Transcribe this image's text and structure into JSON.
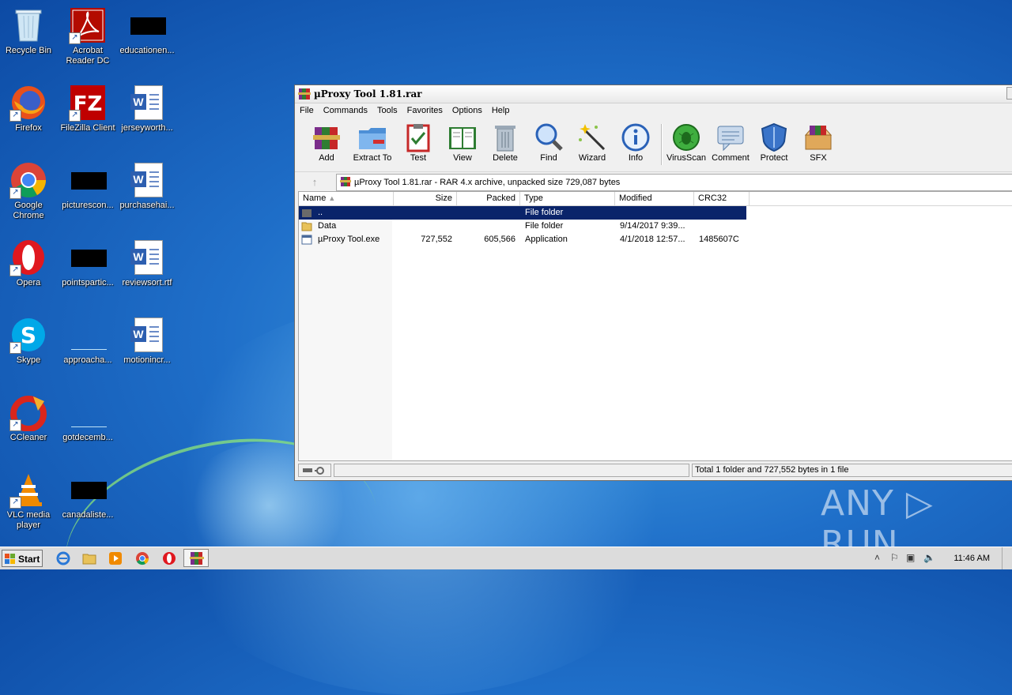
{
  "desktop_icons": [
    {
      "label": "Recycle Bin"
    },
    {
      "label": "Acrobat Reader DC"
    },
    {
      "label": "educationen..."
    },
    {
      "label": "Firefox"
    },
    {
      "label": "FileZilla Client"
    },
    {
      "label": "jerseyworth..."
    },
    {
      "label": "Google Chrome"
    },
    {
      "label": "picturescon..."
    },
    {
      "label": "purchasehai..."
    },
    {
      "label": "Opera"
    },
    {
      "label": "pointspartic..."
    },
    {
      "label": "reviewsort.rtf"
    },
    {
      "label": "Skype"
    },
    {
      "label": "approacha..."
    },
    {
      "label": "motionincr..."
    },
    {
      "label": "CCleaner"
    },
    {
      "label": "gotdecemb..."
    },
    {
      "label": "VLC media player"
    },
    {
      "label": "canadaliste..."
    }
  ],
  "window": {
    "title": "µProxy Tool 1.81.rar",
    "menu": [
      "File",
      "Commands",
      "Tools",
      "Favorites",
      "Options",
      "Help"
    ],
    "toolbar": [
      "Add",
      "Extract To",
      "Test",
      "View",
      "Delete",
      "Find",
      "Wizard",
      "Info",
      "VirusScan",
      "Comment",
      "Protect",
      "SFX"
    ],
    "address": "µProxy Tool 1.81.rar - RAR 4.x archive, unpacked size 729,087 bytes",
    "up_arrow": "↑",
    "columns": [
      "Name",
      "Size",
      "Packed",
      "Type",
      "Modified",
      "CRC32"
    ],
    "rows": [
      {
        "name": "..",
        "size": "",
        "packed": "",
        "type": "File folder",
        "modified": "",
        "crc": ""
      },
      {
        "name": "Data",
        "size": "",
        "packed": "",
        "type": "File folder",
        "modified": "9/14/2017 9:39...",
        "crc": ""
      },
      {
        "name": "µProxy Tool.exe",
        "size": "727,552",
        "packed": "605,566",
        "type": "Application",
        "modified": "4/1/2018 12:57...",
        "crc": "1485607C"
      }
    ],
    "status": "Total 1 folder and 727,552 bytes in 1 file"
  },
  "taskbar": {
    "start_label": "Start",
    "clock": "11:46 AM"
  },
  "watermark": "ANY ▷ RUN"
}
